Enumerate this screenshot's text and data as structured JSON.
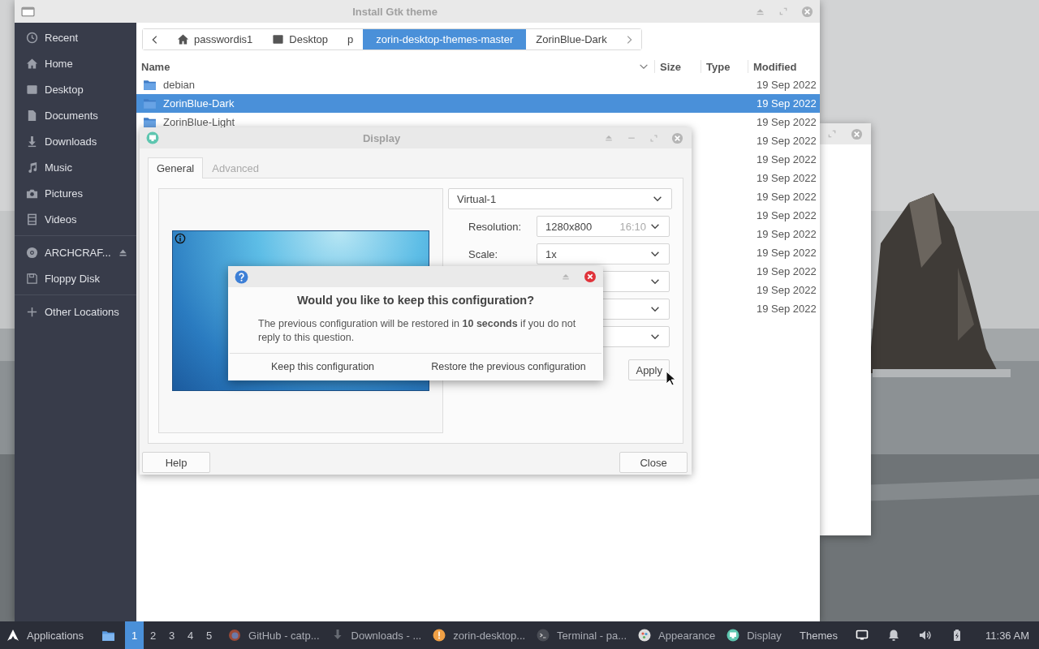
{
  "file_chooser": {
    "title": "Install Gtk theme",
    "sidebar": {
      "sections": [
        {
          "items": [
            {
              "label": "Recent",
              "kind": "recent"
            },
            {
              "label": "Home",
              "kind": "home"
            },
            {
              "label": "Desktop",
              "kind": "desktop"
            },
            {
              "label": "Documents",
              "kind": "document"
            },
            {
              "label": "Downloads",
              "kind": "download"
            },
            {
              "label": "Music",
              "kind": "music"
            },
            {
              "label": "Pictures",
              "kind": "camera"
            },
            {
              "label": "Videos",
              "kind": "film"
            }
          ]
        },
        {
          "items": [
            {
              "label": "ARCHCRAF...",
              "kind": "disc",
              "ejectable": true
            },
            {
              "label": "Floppy Disk",
              "kind": "floppy",
              "ejectable": false
            }
          ]
        },
        {
          "items": [
            {
              "label": "Other Locations",
              "kind": "plus"
            }
          ]
        }
      ]
    },
    "path_bar": {
      "segments": [
        {
          "label": "passwordis1",
          "kind": "home",
          "selected": false
        },
        {
          "label": "Desktop",
          "kind": "desktop",
          "selected": false
        },
        {
          "label": "p",
          "kind": "plain",
          "selected": false
        },
        {
          "label": "zorin-desktop-themes-master",
          "kind": "plain",
          "selected": true
        },
        {
          "label": "ZorinBlue-Dark",
          "kind": "plain",
          "selected": false
        }
      ]
    },
    "columns": [
      "Name",
      "Size",
      "Type",
      "Modified"
    ],
    "rows": [
      {
        "name": "debian",
        "modified": "19 Sep 2022",
        "selected": false
      },
      {
        "name": "ZorinBlue-Dark",
        "modified": "19 Sep 2022",
        "selected": true
      },
      {
        "name": "ZorinBlue-Light",
        "modified": "19 Sep 2022",
        "selected": false
      },
      {
        "modified": "19 Sep 2022",
        "selected": false
      },
      {
        "modified": "19 Sep 2022",
        "selected": false
      },
      {
        "modified": "19 Sep 2022",
        "selected": false
      },
      {
        "modified": "19 Sep 2022",
        "selected": false
      },
      {
        "modified": "19 Sep 2022",
        "selected": false
      },
      {
        "modified": "19 Sep 2022",
        "selected": false
      },
      {
        "modified": "19 Sep 2022",
        "selected": false
      },
      {
        "modified": "19 Sep 2022",
        "selected": false
      },
      {
        "modified": "19 Sep 2022",
        "selected": false
      },
      {
        "modified": "19 Sep 2022",
        "selected": false
      }
    ]
  },
  "display_dialog": {
    "title": "Display",
    "tabs": [
      {
        "label": "General",
        "selected": true
      },
      {
        "label": "Advanced",
        "selected": false
      }
    ],
    "output": "Virtual-1",
    "settings": [
      {
        "kind": "dropdown",
        "label": "Resolution:",
        "value": "1280x800",
        "aspect": "16:10"
      },
      {
        "kind": "dropdown",
        "label": "Scale:",
        "value": "1x"
      },
      {
        "kind": "dropdown"
      },
      {
        "kind": "dropdown"
      },
      {
        "kind": "dropdown"
      }
    ],
    "apply_button": "Apply",
    "help_button": "Help",
    "close_button": "Close"
  },
  "confirm_dialog": {
    "heading": "Would you like to keep this configuration?",
    "message": "The previous configuration will be restored in **10 seconds** if you do not reply to this question.",
    "buttons": [
      "Keep this configuration",
      "Restore the previous configuration"
    ]
  },
  "taskbar": {
    "menu": "Applications",
    "workspaces": [
      {
        "label": "1",
        "selected": true
      },
      {
        "label": "2",
        "selected": false
      },
      {
        "label": "3",
        "selected": false
      },
      {
        "label": "4",
        "selected": false
      },
      {
        "label": "5",
        "selected": false
      }
    ],
    "tasks": [
      {
        "label": "GitHub - catp...",
        "kind": "browser"
      },
      {
        "label": "Downloads - ...",
        "kind": "download"
      },
      {
        "label": "zorin-desktop...",
        "kind": "archive"
      },
      {
        "label": "Terminal - pa...",
        "kind": "terminal"
      },
      {
        "label": "Appearance",
        "kind": "appearance"
      },
      {
        "label": "Display",
        "kind": "display"
      }
    ],
    "themes": "Themes",
    "clock": "11:36 AM"
  }
}
